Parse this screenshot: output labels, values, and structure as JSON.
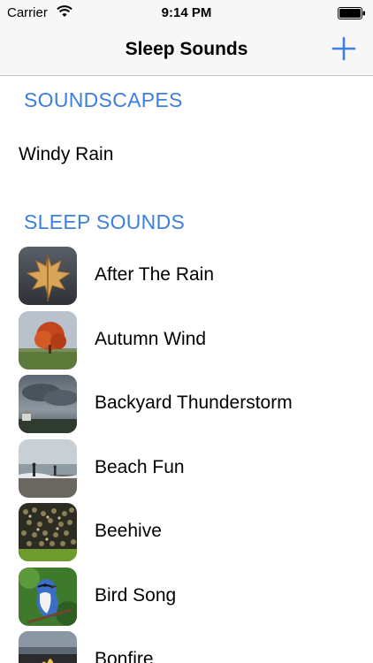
{
  "status_bar": {
    "carrier": "Carrier",
    "time": "9:14 PM",
    "wifi_icon": "wifi-icon",
    "battery_icon": "battery-icon"
  },
  "nav_bar": {
    "title": "Sleep Sounds",
    "add_icon": "plus-icon",
    "accent_color": "#3d7fe0"
  },
  "sections": {
    "soundscapes": {
      "header": "SOUNDSCAPES",
      "items": [
        "Windy Rain"
      ]
    },
    "sleep_sounds": {
      "header": "SLEEP SOUNDS",
      "items": [
        {
          "label": "After The Rain",
          "thumbnail": "maple-leaf"
        },
        {
          "label": "Autumn Wind",
          "thumbnail": "autumn-tree"
        },
        {
          "label": "Backyard Thunderstorm",
          "thumbnail": "storm-clouds"
        },
        {
          "label": "Beach Fun",
          "thumbnail": "beach"
        },
        {
          "label": "Beehive",
          "thumbnail": "bees"
        },
        {
          "label": "Bird Song",
          "thumbnail": "blue-jay"
        },
        {
          "label": "Bonfire",
          "thumbnail": "bonfire"
        }
      ]
    }
  }
}
